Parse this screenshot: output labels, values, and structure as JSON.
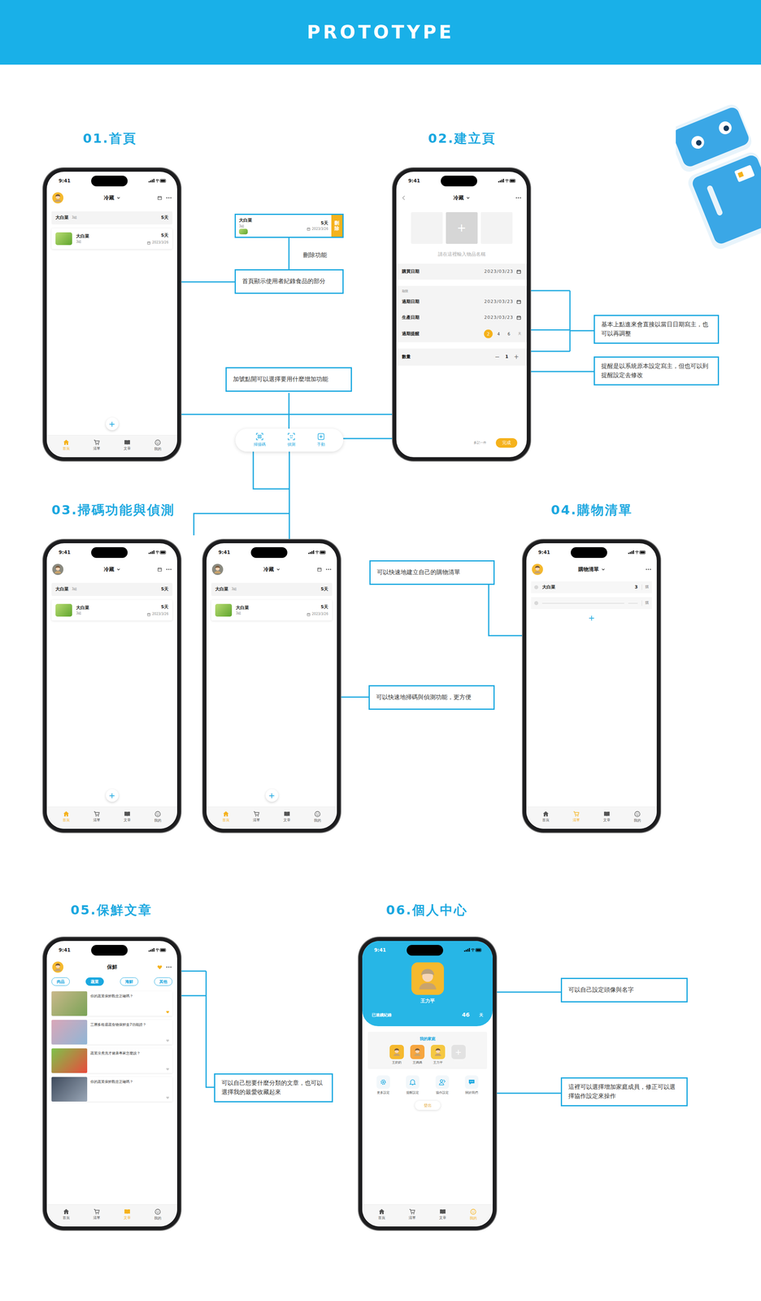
{
  "header": {
    "title": "PROTOTYPE"
  },
  "sections": [
    {
      "title": "01.首頁"
    },
    {
      "title": "02.建立頁"
    },
    {
      "title": "03.掃碼功能與偵測"
    },
    {
      "title": "04.購物清單"
    },
    {
      "title": "05.保鮮文章"
    },
    {
      "title": "06.個人中心"
    }
  ],
  "delete_demo": {
    "name": "大白菜",
    "count": "3組",
    "days": "5天",
    "date": "2023/3/26",
    "action": "刪除",
    "label": "刪除功能"
  },
  "add_menu": [
    {
      "label": "掃描碼"
    },
    {
      "label": "偵測"
    },
    {
      "label": "手動"
    }
  ],
  "notes": [
    {
      "text": "首頁顯示使用者紀錄食品的部分"
    },
    {
      "text": "加號點開可以選擇要用什麼增加功能"
    },
    {
      "text": "基本上點進來會直接以當日日期寫主，也可以再調整"
    },
    {
      "text": "提醒是以系統原本設定寫主，但也可以到提醒設定去修改"
    },
    {
      "text": "可以快速地建立自己的購物清單"
    },
    {
      "text": "可以快速地掃碼與偵測功能，更方便"
    },
    {
      "text": "可以自己想要什麼分類的文章，也可以選擇我的最愛收藏起來"
    },
    {
      "text": "可以自己設定頭像與名字"
    },
    {
      "text": "這裡可以選擇增加家庭成員，修正可以選擇協作設定來操作"
    }
  ],
  "phones": [
    {
      "kind": "fridge",
      "time": "9:41",
      "title": "冷藏",
      "avatar_color": "#f5b92e",
      "summary": {
        "name": "大白菜",
        "count": "3組",
        "days": "5天"
      },
      "items": [
        {
          "name": "大白菜",
          "count": "3組",
          "days": "5天",
          "date": "2023/3/26"
        }
      ],
      "add": "+",
      "tabs": [
        {
          "label": "首頁",
          "selected": true
        },
        {
          "label": "清單",
          "selected": false
        },
        {
          "label": "文章",
          "selected": false
        },
        {
          "label": "我的",
          "selected": false
        }
      ]
    },
    {
      "kind": "create",
      "time": "9:41",
      "title": "冷藏",
      "photo_add": "+",
      "name_placeholder": "請在這裡輸入物品名稱",
      "fields": [
        {
          "label": "購買日期",
          "value": "2023/03/23"
        }
      ],
      "group_label": "期限",
      "group_fields": [
        {
          "label": "過期日期",
          "value": "2023/03/23"
        },
        {
          "label": "生產日期",
          "value": "2023/03/23"
        }
      ],
      "reminder": {
        "label": "過期提醒",
        "options": [
          {
            "label": "2",
            "selected": true
          },
          {
            "label": "4",
            "selected": false
          },
          {
            "label": "6",
            "selected": false
          }
        ],
        "unit": "天"
      },
      "quantity": {
        "label": "數量",
        "minus": "−",
        "value": "1",
        "plus": "+"
      },
      "secondary": "多記一件",
      "primary": "完成"
    },
    {
      "kind": "fridge",
      "time": "9:41",
      "title": "冷藏",
      "avatar_color": "#8a8a80",
      "summary": {
        "name": "大白菜",
        "count": "3組",
        "days": "5天"
      },
      "items": [
        {
          "name": "大白菜",
          "count": "3組",
          "days": "5天",
          "date": "2023/3/26"
        }
      ],
      "add": "+",
      "tabs": [
        {
          "label": "首頁",
          "selected": true
        },
        {
          "label": "清單",
          "selected": false
        },
        {
          "label": "文章",
          "selected": false
        },
        {
          "label": "我的",
          "selected": false
        }
      ]
    },
    {
      "kind": "fridge",
      "time": "9:41",
      "title": "冷藏",
      "avatar_color": "#8a8a80",
      "summary": {
        "name": "大白菜",
        "count": "3組",
        "days": "5天"
      },
      "items": [
        {
          "name": "大白菜",
          "count": "3組",
          "days": "5天",
          "date": "2023/3/26"
        }
      ],
      "add": "+",
      "tabs": [
        {
          "label": "首頁",
          "selected": true
        },
        {
          "label": "清單",
          "selected": false
        },
        {
          "label": "文章",
          "selected": false
        },
        {
          "label": "我的",
          "selected": false
        }
      ]
    },
    {
      "kind": "shopping",
      "time": "9:41",
      "title": "購物清單",
      "avatar_color": "#f5b92e",
      "rows": [
        {
          "kind": "item",
          "name": "大白菜",
          "qty": "3",
          "action": "購",
          "checked": false
        },
        {
          "kind": "blank",
          "action": "購",
          "checked": false
        }
      ],
      "add": "+",
      "tabs": [
        {
          "label": "首頁",
          "selected": false
        },
        {
          "label": "清單",
          "selected": true
        },
        {
          "label": "文章",
          "selected": false
        },
        {
          "label": "我的",
          "selected": false
        }
      ]
    },
    {
      "kind": "articles",
      "time": "9:41",
      "title": "保鮮",
      "avatar_color": "#f5b92e",
      "favorite_on": true,
      "categories": [
        {
          "label": "肉品",
          "selected": false
        },
        {
          "label": "蔬菜",
          "selected": true
        },
        {
          "label": "海鮮",
          "selected": false
        },
        {
          "label": "其他",
          "selected": false
        }
      ],
      "articles": [
        {
          "title": "你的蔬菜保鮮觀念正確嗎？",
          "favorite": true
        },
        {
          "title": "三層多格週蔬食物保鮮盒7功能證？",
          "favorite": false
        },
        {
          "title": "蔬菜沒煮洗才健康專家怎麼說？",
          "favorite": false
        },
        {
          "title": "你的蔬菜保鮮觀念正確嗎？",
          "favorite": false
        }
      ],
      "tabs": [
        {
          "label": "首頁",
          "selected": false
        },
        {
          "label": "清單",
          "selected": false
        },
        {
          "label": "文章",
          "selected": true
        },
        {
          "label": "我的",
          "selected": false
        }
      ]
    },
    {
      "kind": "profile",
      "time": "9:41",
      "name": "王力平",
      "streak_label": "已連續紀錄",
      "streak_value": "46",
      "streak_unit": "天",
      "family_title": "我的家庭",
      "members": [
        {
          "name": "王奶奶",
          "color": "#f5b92e"
        },
        {
          "name": "王媽媽",
          "color": "#f6a640"
        },
        {
          "name": "王力平",
          "color": "#f5c842"
        }
      ],
      "add_member": "+",
      "settings": [
        {
          "label": "更多設定"
        },
        {
          "label": "提醒設定"
        },
        {
          "label": "協作設定"
        },
        {
          "label": "關於我們"
        }
      ],
      "logout": "登出",
      "tabs": [
        {
          "label": "首頁",
          "selected": false
        },
        {
          "label": "清單",
          "selected": false
        },
        {
          "label": "文章",
          "selected": false
        },
        {
          "label": "我的",
          "selected": true
        }
      ]
    }
  ]
}
